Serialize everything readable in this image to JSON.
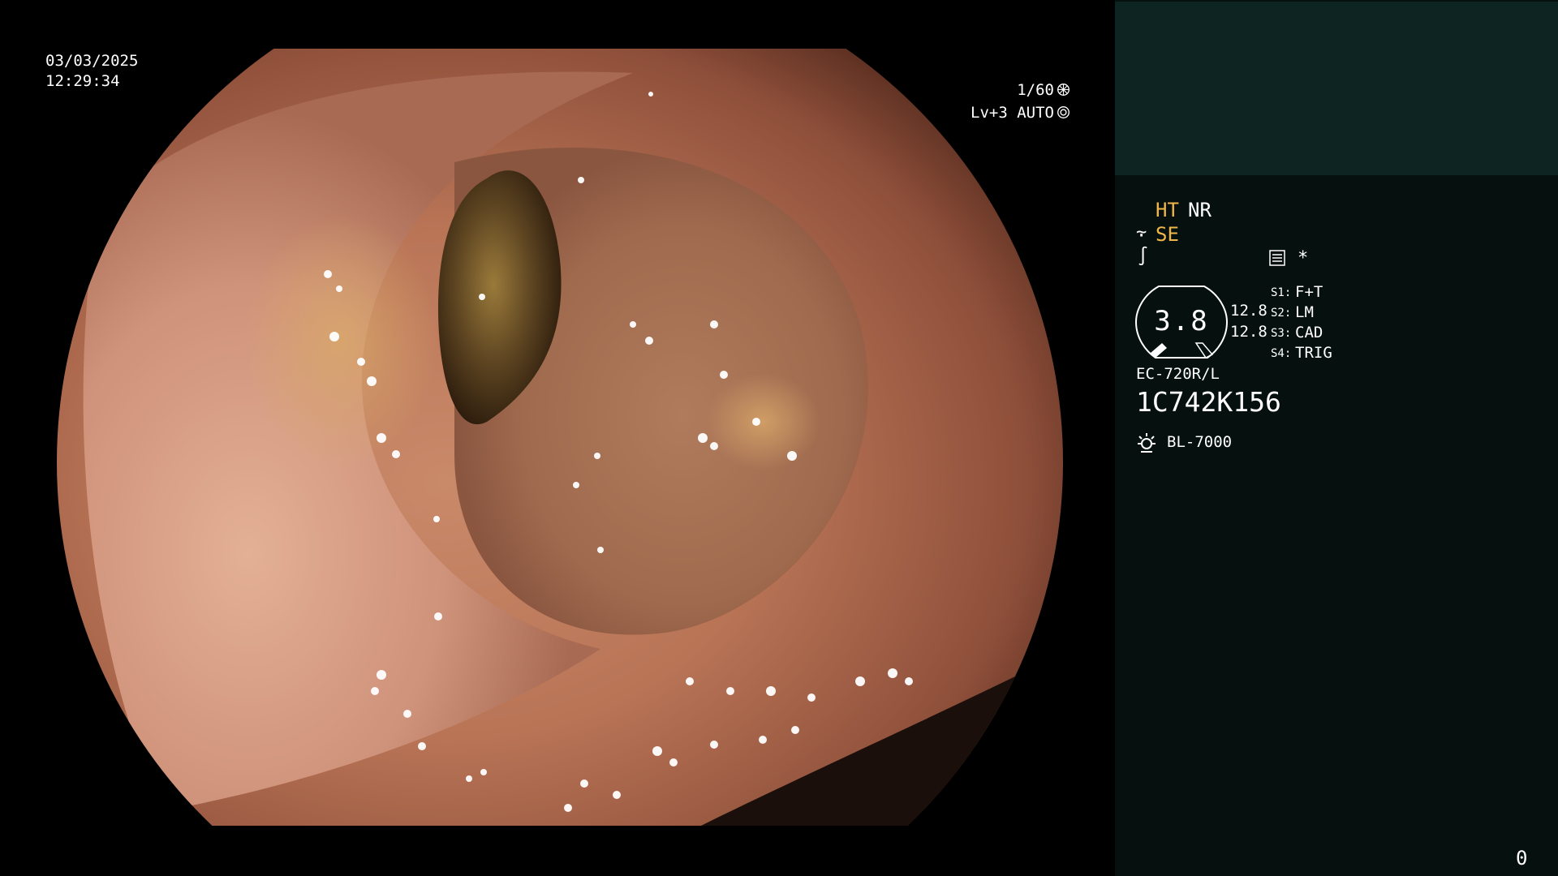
{
  "overlay": {
    "date": "03/03/2025",
    "time": "12:29:34",
    "shutter": "1/60",
    "exposure": "Lv+3 AUTO"
  },
  "panel": {
    "ht": "HT",
    "nr": "NR",
    "se": "SE",
    "asterisk": "*",
    "gauge_value": "3.8",
    "gauge_side_top": "12.8",
    "gauge_side_bottom": "12.8",
    "switches": [
      {
        "key": "S1:",
        "value": "F+T"
      },
      {
        "key": "S2:",
        "value": "LM"
      },
      {
        "key": "S3:",
        "value": "CAD"
      },
      {
        "key": "S4:",
        "value": "TRIG"
      }
    ],
    "scope_model": "EC-720R/L",
    "scope_serial": "1C742K156",
    "light_source": "BL-7000",
    "counter": "0"
  },
  "colors": {
    "panel_top": "#0e2423",
    "panel_bg": "#06100f",
    "accent_amber": "#f0b64a",
    "text": "#ffffff"
  },
  "icons": [
    "shutter-icon",
    "auto-iris-icon",
    "structure-enhance-icon",
    "color-mode-icon",
    "menu-icon",
    "lamp-icon"
  ]
}
